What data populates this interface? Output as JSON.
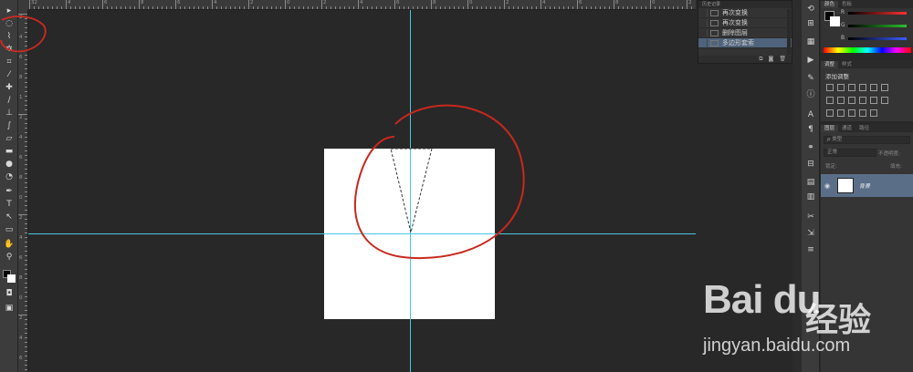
{
  "rulers": {
    "top_labels": [
      "32",
      "4",
      "6",
      "8",
      "6",
      "4",
      "2",
      "0",
      "2",
      "4",
      "6",
      "8",
      "0",
      "2",
      "4",
      "6",
      "8",
      "0",
      "2"
    ],
    "left_labels": [
      "2",
      "4",
      "6",
      "8",
      "1",
      "2",
      "4",
      "6",
      "8",
      "0",
      "2",
      "4",
      "6",
      "8",
      "0",
      "2",
      "4",
      "6"
    ]
  },
  "history": {
    "title": "历史记录",
    "items": [
      {
        "label": "再次变换",
        "selected": false
      },
      {
        "label": "再次变换",
        "selected": false
      },
      {
        "label": "删除图层",
        "selected": false
      },
      {
        "label": "多边形套索",
        "selected": true
      }
    ]
  },
  "color_panel": {
    "tabs": [
      "颜色",
      "色板"
    ],
    "channels": [
      {
        "label": "R",
        "color": "#ff3030"
      },
      {
        "label": "G",
        "color": "#2fbf2f"
      },
      {
        "label": "B",
        "color": "#3a5bff"
      }
    ]
  },
  "adjustments": {
    "tabs": [
      "调整",
      "样式"
    ],
    "heading": "添加调整"
  },
  "layers": {
    "tabs": [
      "图层",
      "通道",
      "路径"
    ],
    "filter_label": "ρ 类型",
    "blend_mode": "正常",
    "opacity_label": "不透明度:",
    "lock_label": "锁定:",
    "fill_label": "填充:",
    "layer_name": "背景"
  },
  "canvas": {
    "background": "#282828",
    "guide_color": "#4ac6e0",
    "annotation_color": "#c8281e"
  },
  "watermark": {
    "logo": "Bai du",
    "brand_cn": "经验",
    "url": "jingyan.baidu.com"
  }
}
